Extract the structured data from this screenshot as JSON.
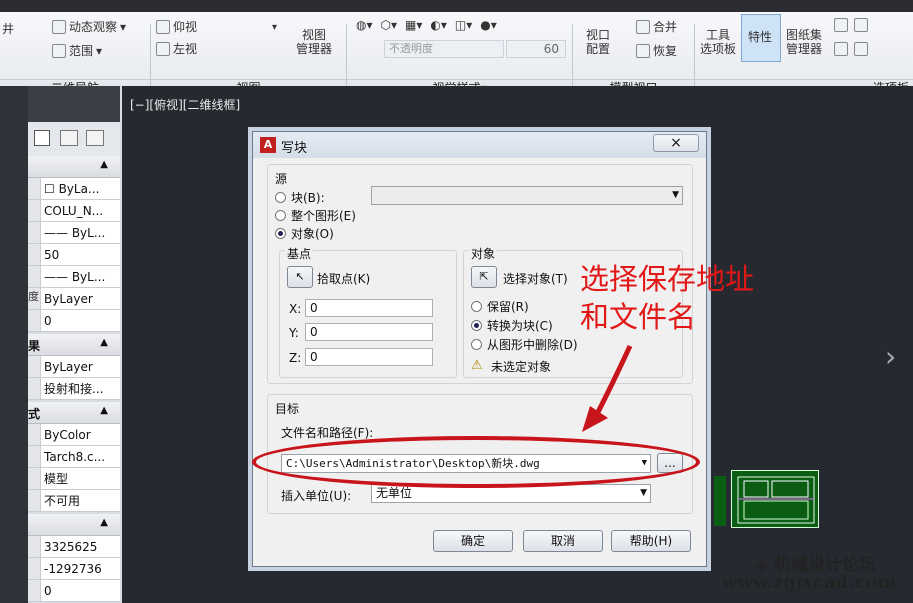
{
  "ribbon": {
    "nav_item": "井",
    "dynamic_observe": "动态观察",
    "range": "范围",
    "view_top": "仰视",
    "view_left": "左视",
    "view_manager": "视图",
    "view_manager2": "管理器",
    "opacity_placeholder": "不透明度",
    "opacity_value": "60",
    "viewport": "视口",
    "viewport2": "配置",
    "merge": "合并",
    "restore": "恢复",
    "tools": "工具",
    "tools2": "选项板",
    "properties": "特性",
    "sheetset": "图纸集",
    "sheetset2": "管理器",
    "groups": {
      "nav": "二维导航",
      "view": "视图",
      "visual": "视觉样式",
      "model_viewport": "模型视口",
      "palettes": "选项板"
    }
  },
  "canvas": {
    "view_label": "[−][俯视][二维线框]"
  },
  "properties_panel": {
    "rows": [
      {
        "k": "",
        "v": "☐ ByLa..."
      },
      {
        "k": "",
        "v": "COLU_N..."
      },
      {
        "k": "",
        "v": "—— ByL..."
      },
      {
        "k": "",
        "v": "50"
      },
      {
        "k": "",
        "v": "—— ByL..."
      },
      {
        "k": "度",
        "v": "ByLayer"
      },
      {
        "k": "",
        "v": "0"
      }
    ],
    "sections": [
      {
        "title": "",
        "arrow": "▲"
      },
      {
        "title": "果",
        "arrow": "▲"
      },
      {
        "title": "式",
        "arrow": "▲"
      },
      {
        "title": "",
        "arrow": "▲"
      }
    ],
    "rows2": [
      {
        "k": "",
        "v": "ByLayer"
      },
      {
        "k": "",
        "v": "投射和接..."
      }
    ],
    "rows3": [
      {
        "k": "",
        "v": "ByColor"
      },
      {
        "k": "",
        "v": "Tarch8.c..."
      },
      {
        "k": "",
        "v": "模型"
      },
      {
        "k": "",
        "v": "不可用"
      }
    ],
    "rows4": [
      {
        "k": "",
        "v": "3325625"
      },
      {
        "k": "",
        "v": "-1292736"
      },
      {
        "k": "",
        "v": "0"
      }
    ]
  },
  "dialog": {
    "title": "写块",
    "close": "×",
    "source_label": "源",
    "block_opt": "块(B):",
    "whole_drawing": "整个图形(E)",
    "objects_opt": "对象(O)",
    "basepoint_label": "基点",
    "pick_point": "拾取点(K)",
    "x_label": "X:",
    "x_val": "0",
    "y_label": "Y:",
    "y_val": "0",
    "z_label": "Z:",
    "z_val": "0",
    "objects_label": "对象",
    "select_objects": "选择对象(T)",
    "retain": "保留(R)",
    "convert": "转换为块(C)",
    "delete": "从图形中删除(D)",
    "no_selection": "未选定对象",
    "target_label": "目标",
    "filename_label": "文件名和路径(F):",
    "filename": "C:\\Users\\Administrator\\Desktop\\新块.dwg",
    "browse": "...",
    "insert_units_label": "插入单位(U):",
    "insert_units": "无单位",
    "ok": "确定",
    "cancel": "取消",
    "help": "帮助(H)"
  },
  "annotation": {
    "line1": "选择保存地址",
    "line2": "和文件名"
  },
  "watermark": {
    "name": "◈ 机械设计论坛",
    "url": "www.zgjxcad.com"
  }
}
